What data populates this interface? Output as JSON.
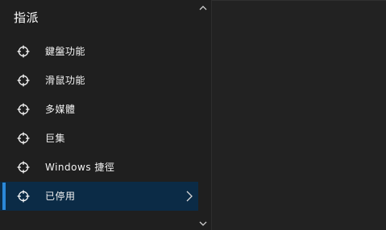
{
  "title": "指派",
  "menu": {
    "items": [
      {
        "label": "鍵盤功能",
        "icon": "crosshair-icon",
        "selected": false
      },
      {
        "label": "滑鼠功能",
        "icon": "crosshair-icon",
        "selected": false
      },
      {
        "label": "多媒體",
        "icon": "crosshair-icon",
        "selected": false
      },
      {
        "label": "巨集",
        "icon": "crosshair-icon",
        "selected": false
      },
      {
        "label": "Windows 捷徑",
        "icon": "crosshair-icon",
        "selected": false
      },
      {
        "label": "已停用",
        "icon": "crosshair-icon",
        "selected": true
      }
    ]
  },
  "scroll": {
    "up_icon": "chevron-up-icon",
    "down_icon": "chevron-down-icon"
  },
  "colors": {
    "background": "#1f1f1f",
    "selected_background": "#0b2b46",
    "accent": "#2b88d8",
    "text": "#ffffff"
  }
}
